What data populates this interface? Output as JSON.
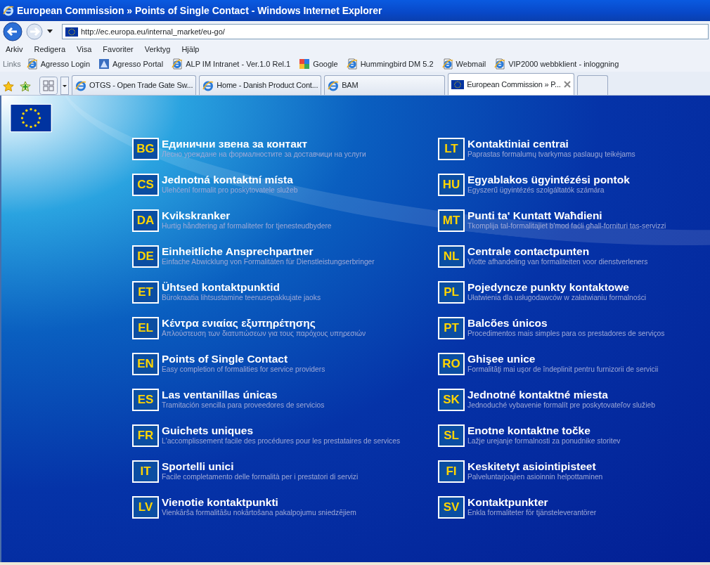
{
  "window": {
    "title": "European Commission » Points of Single Contact - Windows Internet Explorer"
  },
  "address": {
    "url": "http://ec.europa.eu/internal_market/eu-go/"
  },
  "menu": [
    "Arkiv",
    "Redigera",
    "Visa",
    "Favoriter",
    "Verktyg",
    "Hjälp"
  ],
  "links_bar": {
    "label": "Links",
    "items": [
      {
        "label": "Agresso Login",
        "kind": "page"
      },
      {
        "label": "Agresso Portal",
        "kind": "portal"
      },
      {
        "label": "ALP IM Intranet - Ver.1.0 Rel.1",
        "kind": "page"
      },
      {
        "label": "Google",
        "kind": "google"
      },
      {
        "label": "Hummingbird DM 5.2",
        "kind": "page"
      },
      {
        "label": "Webmail",
        "kind": "page"
      },
      {
        "label": "VIP2000 webbklient - inloggning",
        "kind": "page"
      }
    ]
  },
  "tabs": [
    {
      "label": "OTGS - Open Trade Gate Sw...",
      "kind": "ie",
      "selected": false
    },
    {
      "label": "Home - Danish Product Cont...",
      "kind": "ie",
      "selected": false
    },
    {
      "label": "BAM",
      "kind": "ie",
      "selected": false
    },
    {
      "label": "European Commission » P...",
      "kind": "flag",
      "selected": true
    }
  ],
  "columns": [
    [
      {
        "code": "BG",
        "title": "Единични звена за контакт",
        "subtitle": "Лесно уреждане на формалностите за доставчици на услуги"
      },
      {
        "code": "CS",
        "title": "Jednotná kontaktní místa",
        "subtitle": "Ulehčení formalit pro poskytovatele služeb"
      },
      {
        "code": "DA",
        "title": "Kvikskranker",
        "subtitle": "Hurtig håndtering af formaliteter for tjenesteudbydere"
      },
      {
        "code": "DE",
        "title": "Einheitliche Ansprechpartner",
        "subtitle": "Einfache Abwicklung von Formalitäten für Dienstleistungserbringer"
      },
      {
        "code": "ET",
        "title": "Ühtsed kontaktpunktid",
        "subtitle": "Bürokraatia lihtsustamine teenusepakkujate jaoks"
      },
      {
        "code": "EL",
        "title": "Κέντρα ενιαίας εξυπηρέτησης",
        "subtitle": "Απλούστευση των διατυπώσεων για τους παρόχους υπηρεσιών"
      },
      {
        "code": "EN",
        "title": "Points of Single Contact",
        "subtitle": "Easy completion of formalities for service providers"
      },
      {
        "code": "ES",
        "title": "Las ventanillas únicas",
        "subtitle": "Tramitación sencilla para proveedores de servicios"
      },
      {
        "code": "FR",
        "title": "Guichets uniques",
        "subtitle": "L'accomplissement facile des procédures pour les prestataires de services"
      },
      {
        "code": "IT",
        "title": "Sportelli unici",
        "subtitle": "Facile completamento delle formalità per i prestatori di servizi"
      },
      {
        "code": "LV",
        "title": "Vienotie kontaktpunkti",
        "subtitle": "Vienkārša formalitāšu nokārtošana pakalpojumu sniedzējiem"
      }
    ],
    [
      {
        "code": "LT",
        "title": "Kontaktiniai centrai",
        "subtitle": "Paprastas formalumų tvarkymas paslaugų teikėjams"
      },
      {
        "code": "HU",
        "title": "Egyablakos ügyintézési pontok",
        "subtitle": "Egyszerű ügyintézés szolgáltatók számára"
      },
      {
        "code": "MT",
        "title": "Punti ta' Kuntatt Waħdieni",
        "subtitle": "Tkomplija tal-formalitajiet b'mod faċli għall-fornituri tas-servizzi"
      },
      {
        "code": "NL",
        "title": "Centrale contactpunten",
        "subtitle": "Vlotte afhandeling van formaliteiten voor dienstverleners"
      },
      {
        "code": "PL",
        "title": "Pojedyncze punkty kontaktowe",
        "subtitle": "Ułatwienia dla usługodawców w załatwianiu formalności"
      },
      {
        "code": "PT",
        "title": "Balcões únicos",
        "subtitle": "Procedimentos mais simples para os prestadores de serviços"
      },
      {
        "code": "RO",
        "title": "Ghişee unice",
        "subtitle": "Formalităţi mai uşor de îndeplinit pentru furnizorii de servicii"
      },
      {
        "code": "SK",
        "title": "Jednotné kontaktné miesta",
        "subtitle": "Jednoduché vybavenie formalít pre poskytovateľov služieb"
      },
      {
        "code": "SL",
        "title": "Enotne kontaktne točke",
        "subtitle": "Lažje urejanje formalnosti za ponudnike storitev"
      },
      {
        "code": "FI",
        "title": "Keskitetyt asiointipisteet",
        "subtitle": "Palveluntarjoajien asioinnin helpottaminen"
      },
      {
        "code": "SV",
        "title": "Kontaktpunkter",
        "subtitle": "Enkla formaliteter för tjänsteleverantörer"
      }
    ]
  ]
}
